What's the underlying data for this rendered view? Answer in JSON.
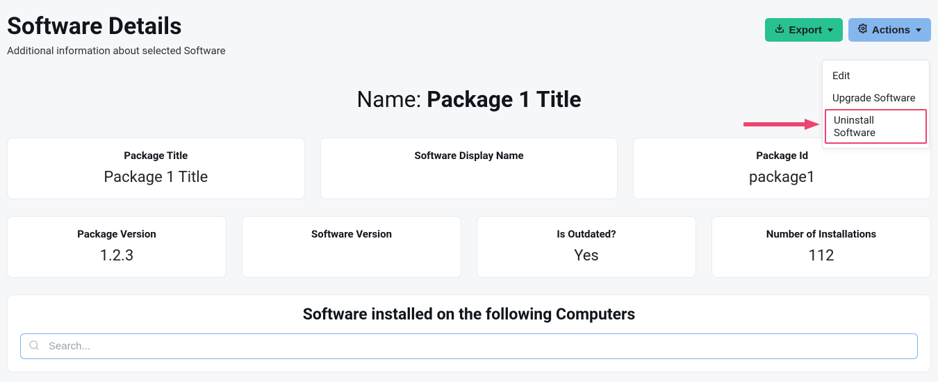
{
  "header": {
    "title": "Software Details",
    "subtitle": "Additional information about selected Software",
    "export_label": "Export",
    "actions_label": "Actions"
  },
  "dropdown": {
    "items": [
      "Edit",
      "Upgrade Software",
      "Uninstall Software"
    ],
    "highlighted_index": 2
  },
  "name_section": {
    "prefix": "Name: ",
    "value": "Package 1 Title"
  },
  "cards_top": [
    {
      "label": "Package Title",
      "value": "Package 1 Title"
    },
    {
      "label": "Software Display Name",
      "value": ""
    },
    {
      "label": "Package Id",
      "value": "package1"
    }
  ],
  "cards_bottom": [
    {
      "label": "Package Version",
      "value": "1.2.3"
    },
    {
      "label": "Software Version",
      "value": ""
    },
    {
      "label": "Is Outdated?",
      "value": "Yes"
    },
    {
      "label": "Number of Installations",
      "value": "112"
    }
  ],
  "computers": {
    "title": "Software installed on the following Computers",
    "search_placeholder": "Search..."
  }
}
